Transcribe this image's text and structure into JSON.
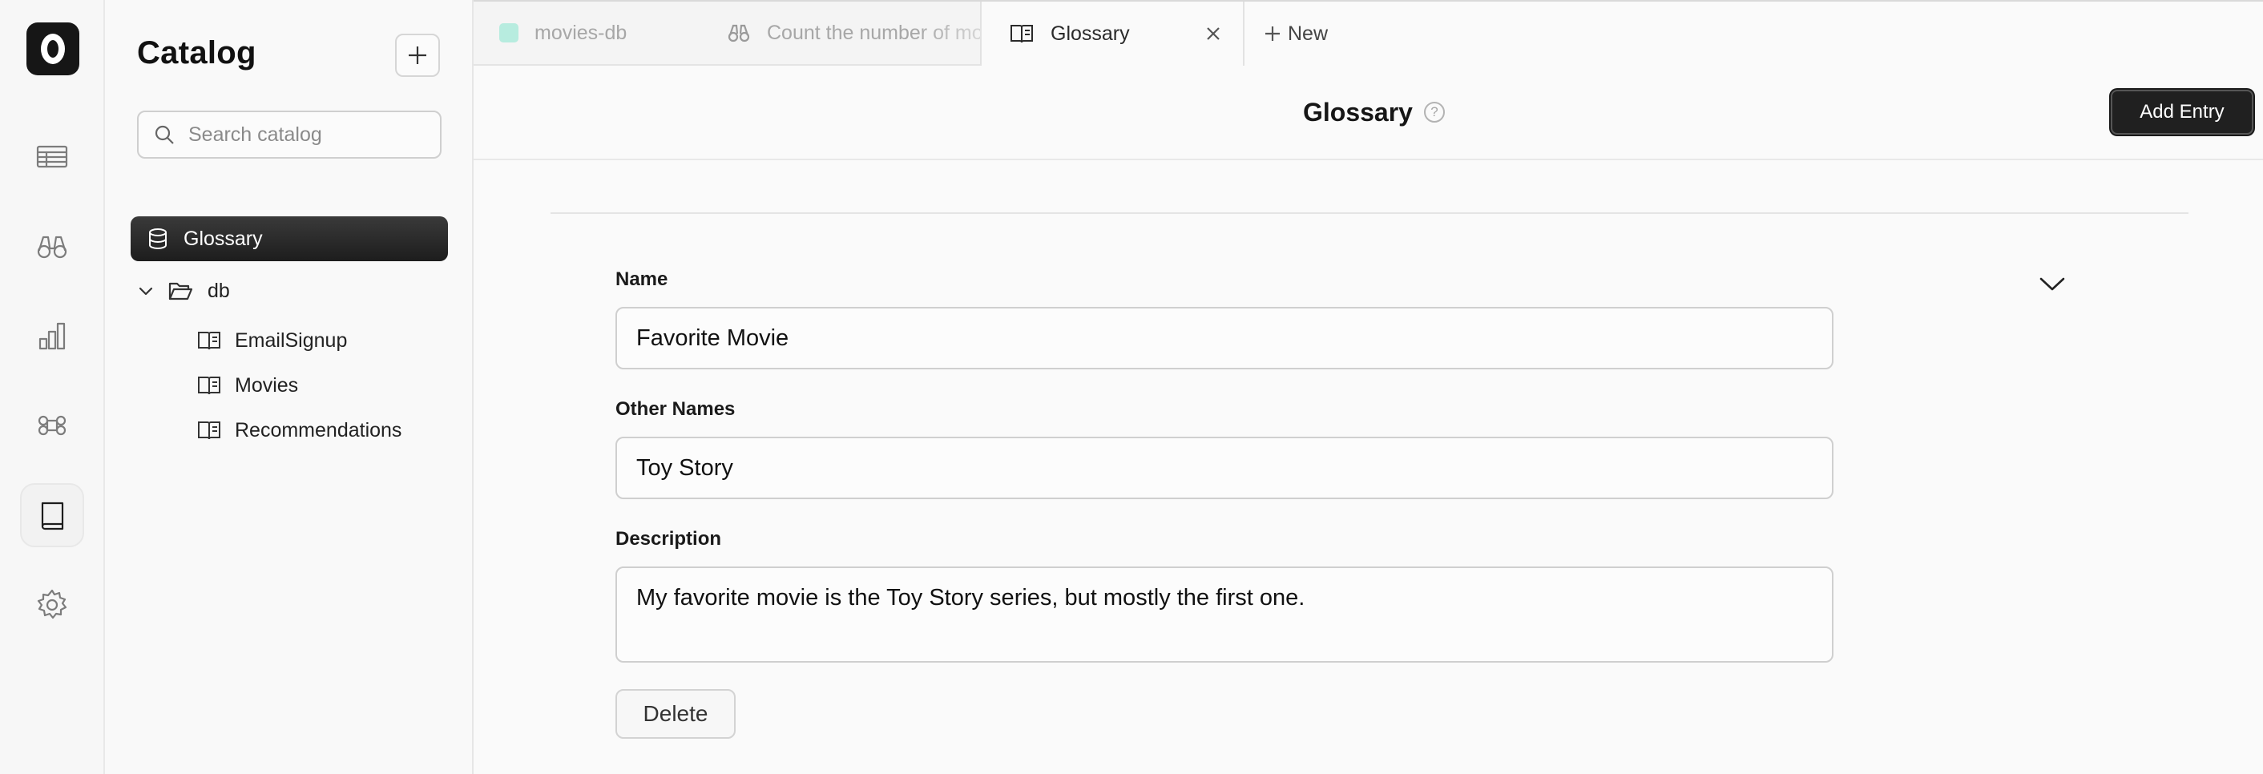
{
  "rail": {
    "items": [
      {
        "icon": "table-icon",
        "active": false
      },
      {
        "icon": "binoculars-icon",
        "active": false
      },
      {
        "icon": "bar-chart-icon",
        "active": false
      },
      {
        "icon": "command-icon",
        "active": false
      },
      {
        "icon": "book-icon",
        "active": true
      },
      {
        "icon": "gear-icon",
        "active": false
      }
    ]
  },
  "catalog": {
    "title": "Catalog",
    "search_placeholder": "Search catalog",
    "selected_item": "Glossary",
    "folder": "db",
    "children": [
      "EmailSignup",
      "Movies",
      "Recommendations"
    ]
  },
  "tabs": {
    "items": [
      "movies-db",
      "Count the number of movies",
      "Glossary"
    ],
    "active": "Glossary",
    "new_label": "New",
    "movies_dot_color": "#b7ecdf"
  },
  "header": {
    "title": "Glossary",
    "help_glyph": "?",
    "add_button": "Add Entry"
  },
  "entry": {
    "name_label": "Name",
    "name_value": "Favorite Movie",
    "other_names_label": "Other Names",
    "other_names_value": "Toy Story",
    "description_label": "Description",
    "description_value": "My favorite movie is the Toy Story series, but mostly the first one.",
    "delete_label": "Delete"
  }
}
